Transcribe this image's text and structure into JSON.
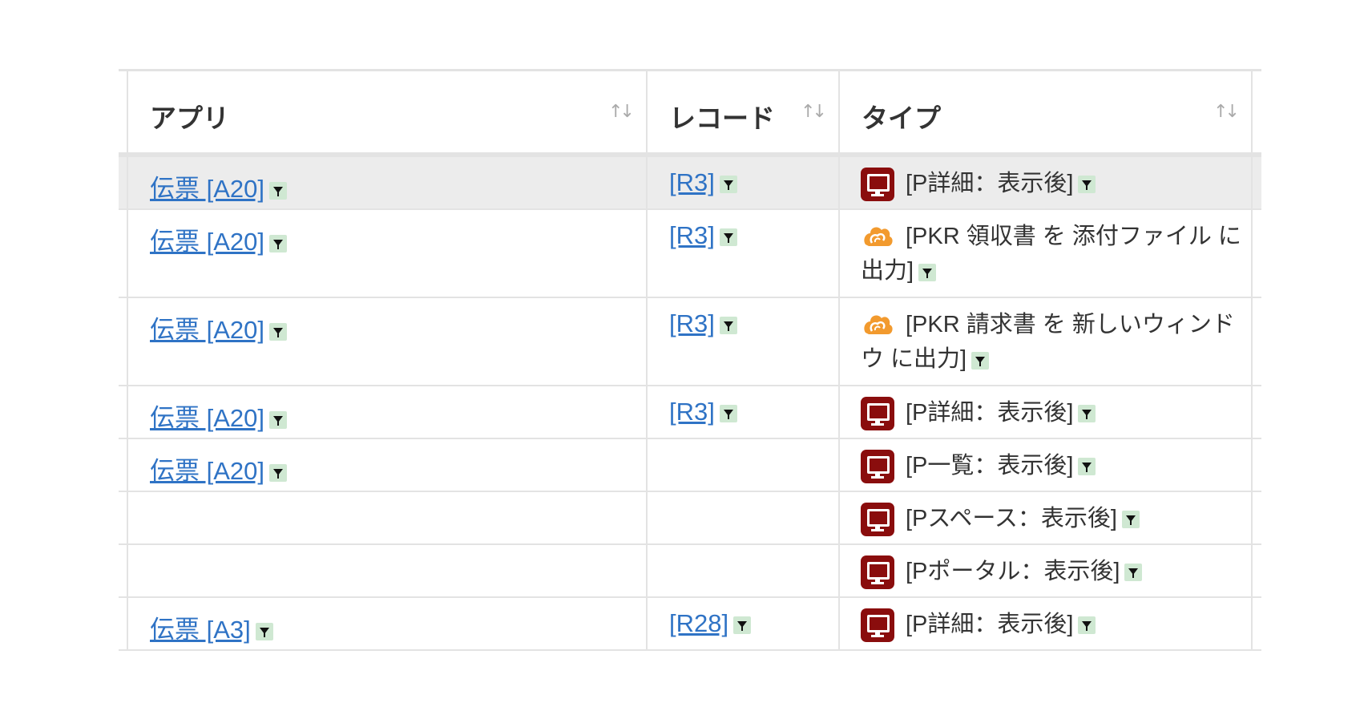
{
  "table": {
    "headers": [
      {
        "label": "アプリ"
      },
      {
        "label": "レコード"
      },
      {
        "label": "タイプ"
      }
    ],
    "sort_icon": "sort-arrows-icon",
    "filter_icon": "filter-icon",
    "rows": [
      {
        "app": "伝票 [A20]",
        "record": "[R3]",
        "type_icon": "desktop-icon",
        "type": "[P詳細：表示後]",
        "selected": true
      },
      {
        "app": "伝票 [A20]",
        "record": "[R3]",
        "type_icon": "kintone-plugin-icon",
        "type": "[PKR 領収書 を 添付ファイル に出力]"
      },
      {
        "app": "伝票 [A20]",
        "record": "[R3]",
        "type_icon": "kintone-plugin-icon",
        "type": "[PKR 請求書 を 新しいウィンドウ に出力]"
      },
      {
        "app": "伝票 [A20]",
        "record": "[R3]",
        "type_icon": "desktop-icon",
        "type": "[P詳細：表示後]"
      },
      {
        "app": "伝票 [A20]",
        "record": "",
        "type_icon": "desktop-icon",
        "type": "[P一覧：表示後]"
      },
      {
        "app": "",
        "record": "",
        "type_icon": "desktop-icon",
        "type": "[Pスペース：表示後]"
      },
      {
        "app": "",
        "record": "",
        "type_icon": "desktop-icon",
        "type": "[Pポータル：表示後]"
      },
      {
        "app": "伝票 [A3]",
        "record": "[R28]",
        "type_icon": "desktop-icon",
        "type": "[P詳細：表示後]"
      }
    ]
  },
  "colors": {
    "link": "#2f73c5",
    "desktop_icon_bg": "#8a0d0d",
    "filter_bg": "#cfe8d2",
    "plugin_icon": "#f29a2e",
    "selected_row_bg": "#ececec"
  }
}
